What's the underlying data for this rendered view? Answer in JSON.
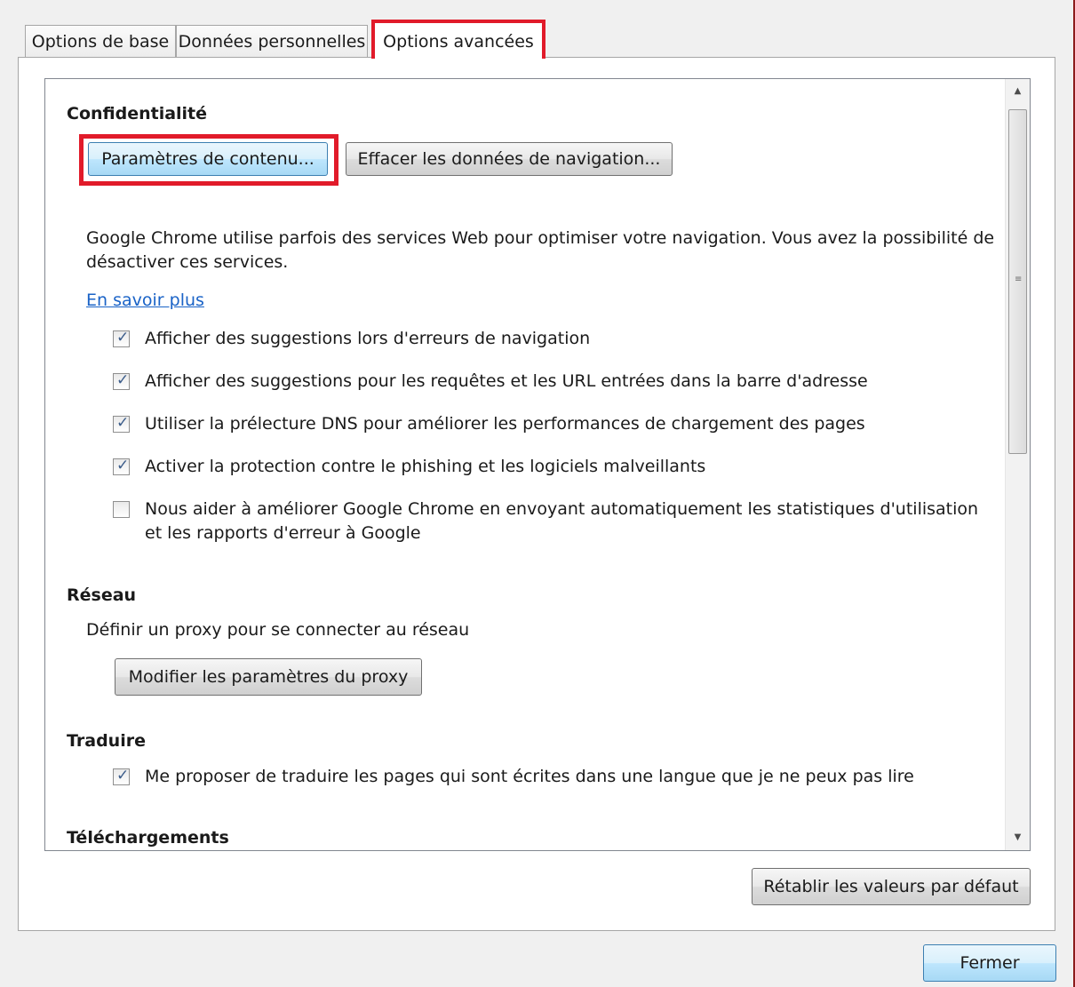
{
  "tabs": [
    {
      "label": "Options de base"
    },
    {
      "label": "Données personnelles"
    },
    {
      "label": "Options avancées",
      "active": true
    }
  ],
  "privacy": {
    "heading": "Confidentialité",
    "content_settings_button": "Paramètres de contenu...",
    "clear_data_button": "Effacer les données de navigation...",
    "description_line1": "Google Chrome utilise parfois des services Web pour optimiser votre navigation. Vous avez la possibilité de",
    "description_line2": "désactiver ces services.",
    "learn_more": "En savoir plus",
    "checkboxes": [
      {
        "label": "Afficher des suggestions lors d'erreurs de navigation",
        "checked": true
      },
      {
        "label": "Afficher des suggestions pour les requêtes et les URL entrées dans la barre d'adresse",
        "checked": true
      },
      {
        "label": "Utiliser la prélecture DNS pour améliorer les performances de chargement des pages",
        "checked": true
      },
      {
        "label": "Activer la protection contre le phishing et les logiciels malveillants",
        "checked": true
      },
      {
        "label_line1": "Nous aider à améliorer Google Chrome en envoyant automatiquement les statistiques d'utilisation",
        "label_line2": "et les rapports d'erreur à Google",
        "checked": false
      }
    ]
  },
  "network": {
    "heading": "Réseau",
    "description": "Définir un proxy pour se connecter au réseau",
    "proxy_button": "Modifier les paramètres du proxy"
  },
  "translate": {
    "heading": "Traduire",
    "checkbox": {
      "label": "Me proposer de traduire les pages qui sont écrites dans une langue que je ne peux pas lire",
      "checked": true
    }
  },
  "downloads": {
    "heading": "Téléchargements"
  },
  "footer": {
    "reset_button": "Rétablir les valeurs par défaut",
    "close_button": "Fermer"
  },
  "colors": {
    "highlight": "#e11b2a",
    "link": "#1a63c7"
  }
}
